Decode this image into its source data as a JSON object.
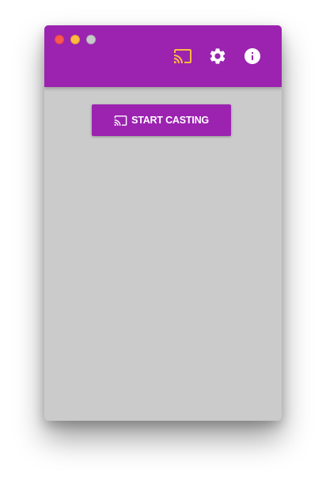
{
  "window": {
    "controls": [
      "close",
      "minimize",
      "zoom"
    ]
  },
  "toolbar": {
    "icons": [
      {
        "name": "cast-icon",
        "color": "#fdbc40"
      },
      {
        "name": "gear-icon",
        "color": "#ffffff"
      },
      {
        "name": "info-icon",
        "color": "#ffffff"
      }
    ]
  },
  "main": {
    "start_button_label": "START CASTING",
    "start_button_icon": "cast-icon"
  },
  "colors": {
    "primary": "#9b23b0",
    "background": "#cbcbcb",
    "cast_accent": "#fdbc40",
    "close": "#fc5753",
    "minimize": "#fdbc40",
    "zoom": "#c8c8cc"
  }
}
